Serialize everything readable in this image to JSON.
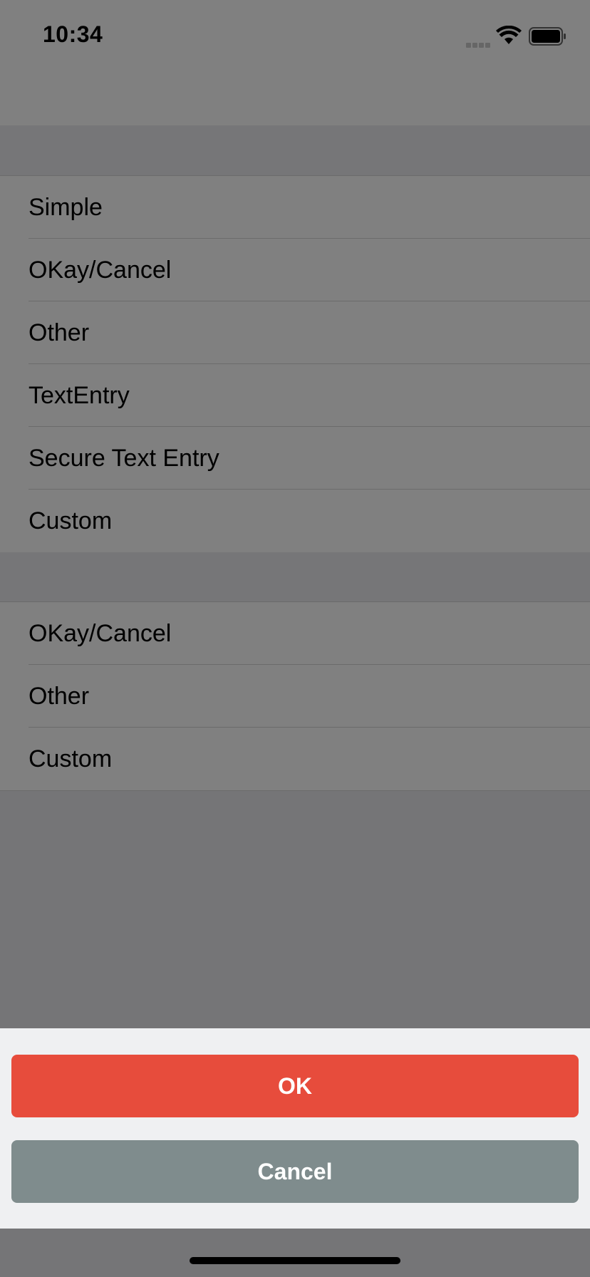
{
  "status_bar": {
    "time": "10:34"
  },
  "group1": {
    "items": [
      {
        "label": "Simple"
      },
      {
        "label": "OKay/Cancel"
      },
      {
        "label": "Other"
      },
      {
        "label": "TextEntry"
      },
      {
        "label": "Secure Text Entry"
      },
      {
        "label": "Custom"
      }
    ]
  },
  "group2": {
    "items": [
      {
        "label": "OKay/Cancel"
      },
      {
        "label": "Other"
      },
      {
        "label": "Custom"
      }
    ]
  },
  "sheet": {
    "ok_label": "OK",
    "cancel_label": "Cancel"
  },
  "colors": {
    "ok_button": "#e74c3c",
    "cancel_button": "#7f8c8d",
    "dim_overlay": "#757577",
    "sheet_background": "#eff0f2"
  },
  "icons": [
    "cellular-signal-icon",
    "wifi-icon",
    "battery-icon"
  ]
}
